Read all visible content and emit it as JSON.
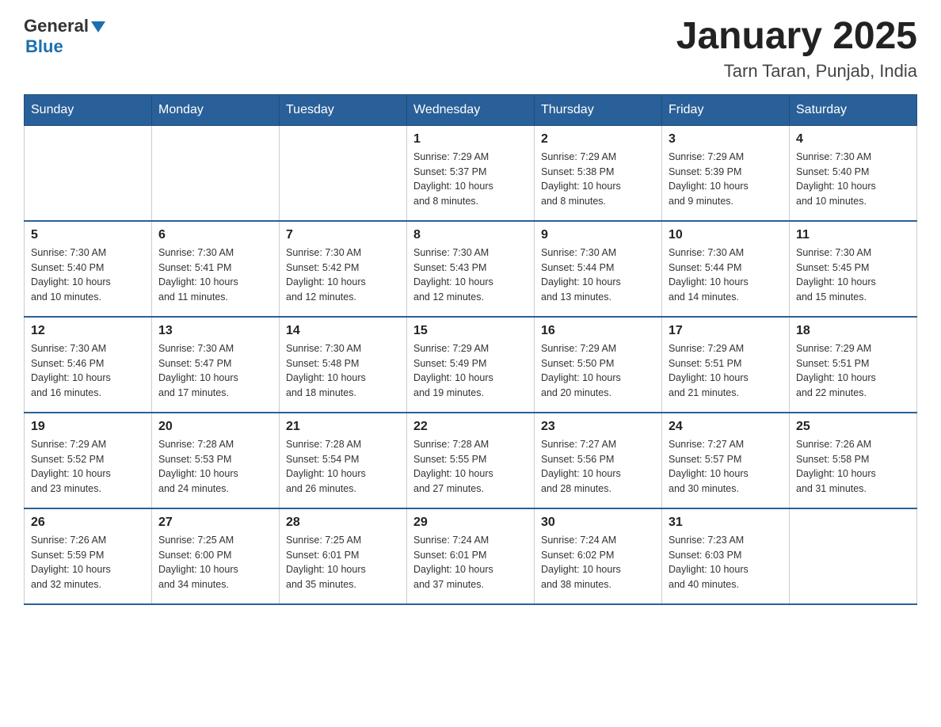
{
  "header": {
    "logo_general": "General",
    "logo_blue": "Blue",
    "title": "January 2025",
    "subtitle": "Tarn Taran, Punjab, India"
  },
  "days_of_week": [
    "Sunday",
    "Monday",
    "Tuesday",
    "Wednesday",
    "Thursday",
    "Friday",
    "Saturday"
  ],
  "weeks": [
    [
      {
        "day": "",
        "info": ""
      },
      {
        "day": "",
        "info": ""
      },
      {
        "day": "",
        "info": ""
      },
      {
        "day": "1",
        "info": "Sunrise: 7:29 AM\nSunset: 5:37 PM\nDaylight: 10 hours\nand 8 minutes."
      },
      {
        "day": "2",
        "info": "Sunrise: 7:29 AM\nSunset: 5:38 PM\nDaylight: 10 hours\nand 8 minutes."
      },
      {
        "day": "3",
        "info": "Sunrise: 7:29 AM\nSunset: 5:39 PM\nDaylight: 10 hours\nand 9 minutes."
      },
      {
        "day": "4",
        "info": "Sunrise: 7:30 AM\nSunset: 5:40 PM\nDaylight: 10 hours\nand 10 minutes."
      }
    ],
    [
      {
        "day": "5",
        "info": "Sunrise: 7:30 AM\nSunset: 5:40 PM\nDaylight: 10 hours\nand 10 minutes."
      },
      {
        "day": "6",
        "info": "Sunrise: 7:30 AM\nSunset: 5:41 PM\nDaylight: 10 hours\nand 11 minutes."
      },
      {
        "day": "7",
        "info": "Sunrise: 7:30 AM\nSunset: 5:42 PM\nDaylight: 10 hours\nand 12 minutes."
      },
      {
        "day": "8",
        "info": "Sunrise: 7:30 AM\nSunset: 5:43 PM\nDaylight: 10 hours\nand 12 minutes."
      },
      {
        "day": "9",
        "info": "Sunrise: 7:30 AM\nSunset: 5:44 PM\nDaylight: 10 hours\nand 13 minutes."
      },
      {
        "day": "10",
        "info": "Sunrise: 7:30 AM\nSunset: 5:44 PM\nDaylight: 10 hours\nand 14 minutes."
      },
      {
        "day": "11",
        "info": "Sunrise: 7:30 AM\nSunset: 5:45 PM\nDaylight: 10 hours\nand 15 minutes."
      }
    ],
    [
      {
        "day": "12",
        "info": "Sunrise: 7:30 AM\nSunset: 5:46 PM\nDaylight: 10 hours\nand 16 minutes."
      },
      {
        "day": "13",
        "info": "Sunrise: 7:30 AM\nSunset: 5:47 PM\nDaylight: 10 hours\nand 17 minutes."
      },
      {
        "day": "14",
        "info": "Sunrise: 7:30 AM\nSunset: 5:48 PM\nDaylight: 10 hours\nand 18 minutes."
      },
      {
        "day": "15",
        "info": "Sunrise: 7:29 AM\nSunset: 5:49 PM\nDaylight: 10 hours\nand 19 minutes."
      },
      {
        "day": "16",
        "info": "Sunrise: 7:29 AM\nSunset: 5:50 PM\nDaylight: 10 hours\nand 20 minutes."
      },
      {
        "day": "17",
        "info": "Sunrise: 7:29 AM\nSunset: 5:51 PM\nDaylight: 10 hours\nand 21 minutes."
      },
      {
        "day": "18",
        "info": "Sunrise: 7:29 AM\nSunset: 5:51 PM\nDaylight: 10 hours\nand 22 minutes."
      }
    ],
    [
      {
        "day": "19",
        "info": "Sunrise: 7:29 AM\nSunset: 5:52 PM\nDaylight: 10 hours\nand 23 minutes."
      },
      {
        "day": "20",
        "info": "Sunrise: 7:28 AM\nSunset: 5:53 PM\nDaylight: 10 hours\nand 24 minutes."
      },
      {
        "day": "21",
        "info": "Sunrise: 7:28 AM\nSunset: 5:54 PM\nDaylight: 10 hours\nand 26 minutes."
      },
      {
        "day": "22",
        "info": "Sunrise: 7:28 AM\nSunset: 5:55 PM\nDaylight: 10 hours\nand 27 minutes."
      },
      {
        "day": "23",
        "info": "Sunrise: 7:27 AM\nSunset: 5:56 PM\nDaylight: 10 hours\nand 28 minutes."
      },
      {
        "day": "24",
        "info": "Sunrise: 7:27 AM\nSunset: 5:57 PM\nDaylight: 10 hours\nand 30 minutes."
      },
      {
        "day": "25",
        "info": "Sunrise: 7:26 AM\nSunset: 5:58 PM\nDaylight: 10 hours\nand 31 minutes."
      }
    ],
    [
      {
        "day": "26",
        "info": "Sunrise: 7:26 AM\nSunset: 5:59 PM\nDaylight: 10 hours\nand 32 minutes."
      },
      {
        "day": "27",
        "info": "Sunrise: 7:25 AM\nSunset: 6:00 PM\nDaylight: 10 hours\nand 34 minutes."
      },
      {
        "day": "28",
        "info": "Sunrise: 7:25 AM\nSunset: 6:01 PM\nDaylight: 10 hours\nand 35 minutes."
      },
      {
        "day": "29",
        "info": "Sunrise: 7:24 AM\nSunset: 6:01 PM\nDaylight: 10 hours\nand 37 minutes."
      },
      {
        "day": "30",
        "info": "Sunrise: 7:24 AM\nSunset: 6:02 PM\nDaylight: 10 hours\nand 38 minutes."
      },
      {
        "day": "31",
        "info": "Sunrise: 7:23 AM\nSunset: 6:03 PM\nDaylight: 10 hours\nand 40 minutes."
      },
      {
        "day": "",
        "info": ""
      }
    ]
  ]
}
